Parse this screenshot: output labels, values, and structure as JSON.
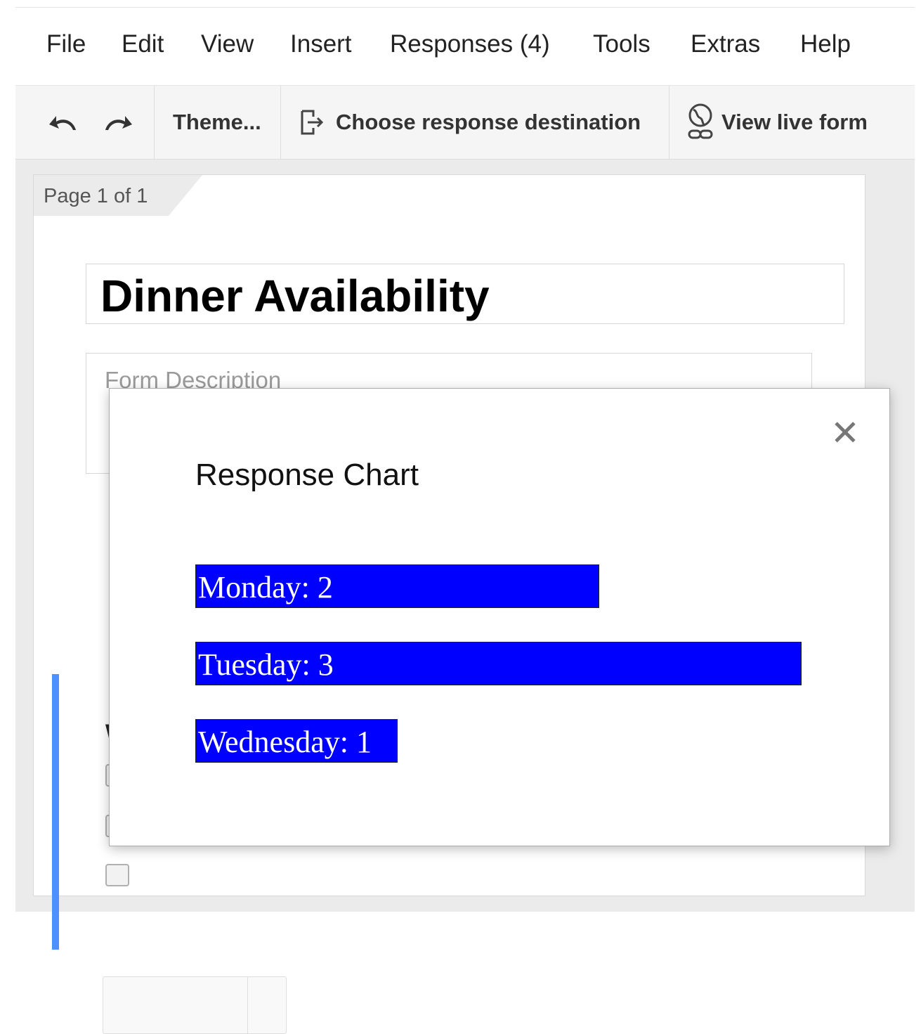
{
  "menubar": {
    "items": [
      "File",
      "Edit",
      "View",
      "Insert",
      "Responses (4)",
      "Tools",
      "Extras",
      "Help"
    ]
  },
  "toolbar": {
    "undo_icon": "undo-icon",
    "redo_icon": "redo-icon",
    "theme_label": "Theme...",
    "destination_label": "Choose response destination",
    "view_live_label": "View live form"
  },
  "form": {
    "page_indicator": "Page 1 of 1",
    "title": "Dinner Availability",
    "description_placeholder": "Form Description",
    "question_partial": "W"
  },
  "modal": {
    "title": "Response Chart",
    "close_icon": "close-icon"
  },
  "colors": {
    "bar_fill": "#0000ff",
    "active_question_bar": "#4d90fe"
  },
  "chart_data": {
    "type": "bar",
    "orientation": "horizontal",
    "title": "Response Chart",
    "categories": [
      "Monday",
      "Tuesday",
      "Wednesday"
    ],
    "values": [
      2,
      3,
      1
    ],
    "labels": [
      "Monday: 2",
      "Tuesday: 3",
      "Wednesday: 1"
    ]
  }
}
